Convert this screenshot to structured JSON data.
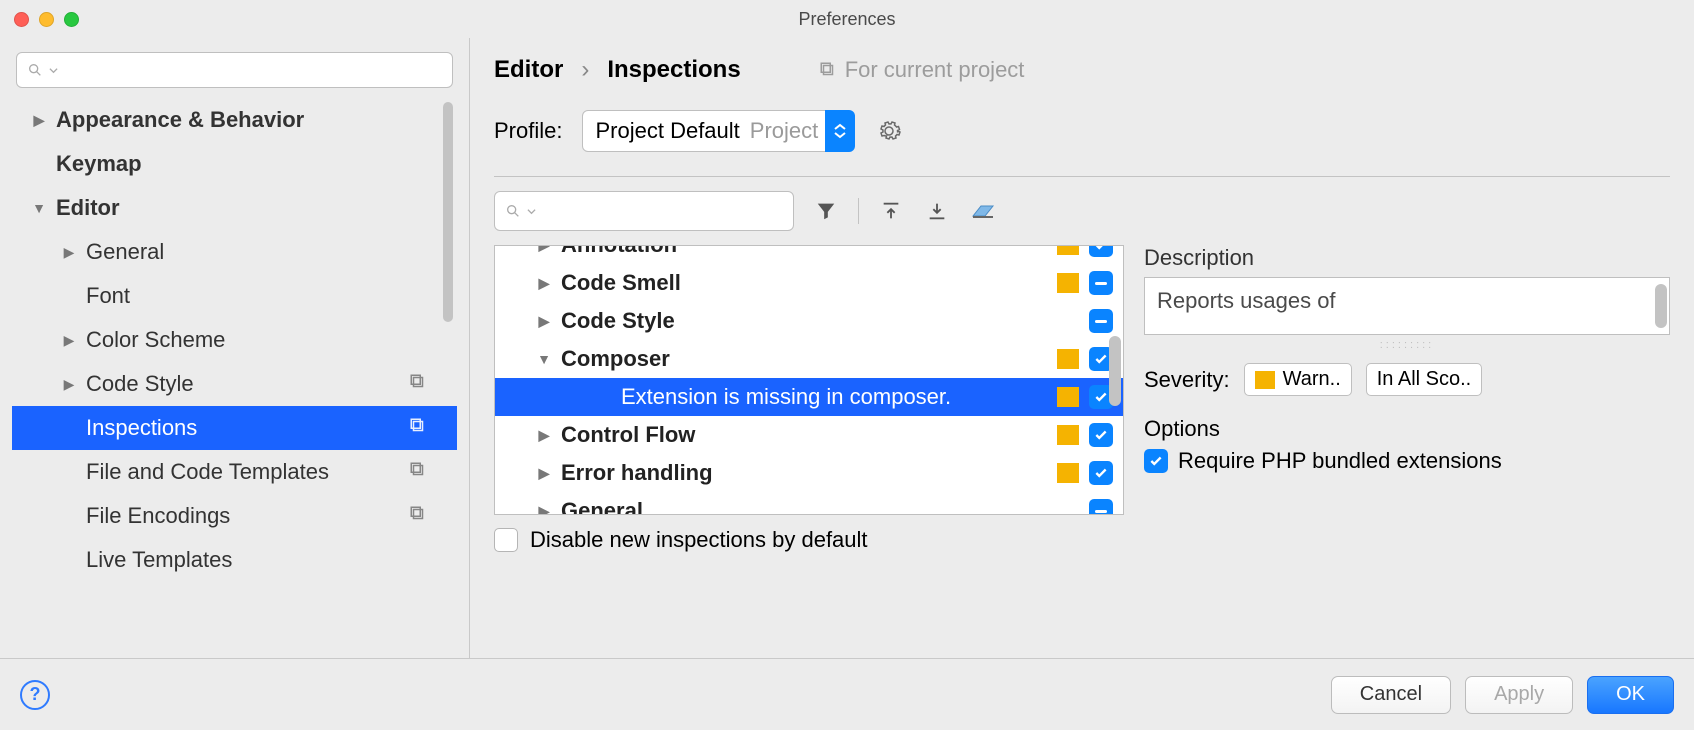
{
  "window": {
    "title": "Preferences"
  },
  "leftSearch": {
    "placeholder": ""
  },
  "nav": {
    "items": [
      {
        "label": "Appearance & Behavior",
        "bold": true,
        "arrow": "right",
        "indent": 0
      },
      {
        "label": "Keymap",
        "bold": true,
        "indent": 0
      },
      {
        "label": "Editor",
        "bold": true,
        "arrow": "down",
        "indent": 0
      },
      {
        "label": "General",
        "arrow": "right",
        "indent": 1
      },
      {
        "label": "Font",
        "indent": 1
      },
      {
        "label": "Color Scheme",
        "arrow": "right",
        "indent": 1
      },
      {
        "label": "Code Style",
        "arrow": "right",
        "indent": 1,
        "stack": true
      },
      {
        "label": "Inspections",
        "indent": 1,
        "stack": true,
        "selected": true
      },
      {
        "label": "File and Code Templates",
        "indent": 1,
        "stack": true
      },
      {
        "label": "File Encodings",
        "indent": 1,
        "stack": true
      },
      {
        "label": "Live Templates",
        "indent": 1
      }
    ]
  },
  "crumbs": {
    "editor": "Editor",
    "page": "Inspections",
    "note": "For current project"
  },
  "profile": {
    "label": "Profile:",
    "name": "Project Default",
    "scope": "Project"
  },
  "rightSearch": {
    "placeholder": ""
  },
  "tree": {
    "rows": [
      {
        "label": "Annotation",
        "bold": true,
        "arrow": "right",
        "swatch": true,
        "check": "check",
        "cut": true
      },
      {
        "label": "Code Smell",
        "bold": true,
        "arrow": "right",
        "swatch": true,
        "check": "dash"
      },
      {
        "label": "Code Style",
        "bold": true,
        "arrow": "right",
        "check": "dash"
      },
      {
        "label": "Composer",
        "bold": true,
        "arrow": "down",
        "swatch": true,
        "check": "check"
      },
      {
        "label": "Extension is missing in composer.",
        "selected": true,
        "child": true,
        "swatch": true,
        "check": "check"
      },
      {
        "label": "Control Flow",
        "bold": true,
        "arrow": "right",
        "swatch": true,
        "check": "check"
      },
      {
        "label": "Error handling",
        "bold": true,
        "arrow": "right",
        "swatch": true,
        "check": "check"
      },
      {
        "label": "General",
        "bold": true,
        "arrow": "right",
        "check": "dash",
        "cut": true
      }
    ]
  },
  "disable": {
    "label": "Disable new inspections by default"
  },
  "description": {
    "heading": "Description",
    "text": "Reports usages of"
  },
  "severity": {
    "label": "Severity:",
    "level": "Warn..",
    "scope": "In All Sco.."
  },
  "options": {
    "heading": "Options",
    "require": "Require PHP bundled extensions"
  },
  "footer": {
    "cancel": "Cancel",
    "apply": "Apply",
    "ok": "OK"
  }
}
